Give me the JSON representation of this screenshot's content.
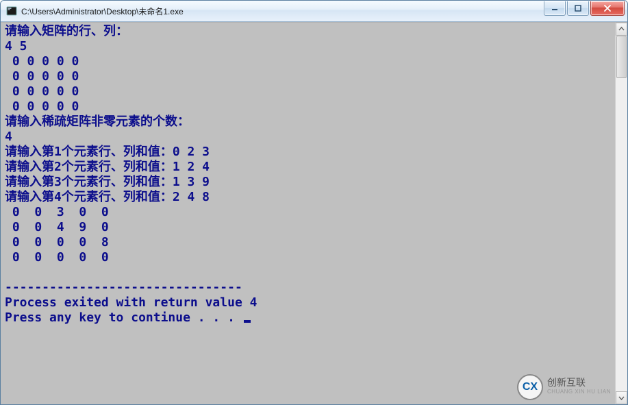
{
  "window": {
    "title": "C:\\Users\\Administrator\\Desktop\\未命名1.exe"
  },
  "console": {
    "prompt_rows_cols": "请输入矩阵的行、列：",
    "rows_cols_input": "4 5",
    "zero_matrix": [
      " 0 0 0 0 0",
      " 0 0 0 0 0",
      " 0 0 0 0 0",
      " 0 0 0 0 0"
    ],
    "prompt_nonzero_count": "请输入稀疏矩阵非零元素的个数：",
    "nonzero_count_input": "4",
    "element_prompts": [
      {
        "label": "请输入第1个元素行、列和值：",
        "value": "0 2 3"
      },
      {
        "label": "请输入第2个元素行、列和值：",
        "value": "1 2 4"
      },
      {
        "label": "请输入第3个元素行、列和值：",
        "value": "1 3 9"
      },
      {
        "label": "请输入第4个元素行、列和值：",
        "value": "2 4 8"
      }
    ],
    "result_matrix": [
      " 0  0  3  0  0",
      " 0  0  4  9  0",
      " 0  0  0  0  8",
      " 0  0  0  0  0"
    ],
    "separator": "--------------------------------",
    "exit_line": "Process exited with return value 4",
    "continue_line": "Press any key to continue . . . "
  },
  "logo": {
    "mark": "CX",
    "cn": "创新互联",
    "py": "CHUANG XIN HU LIAN"
  }
}
